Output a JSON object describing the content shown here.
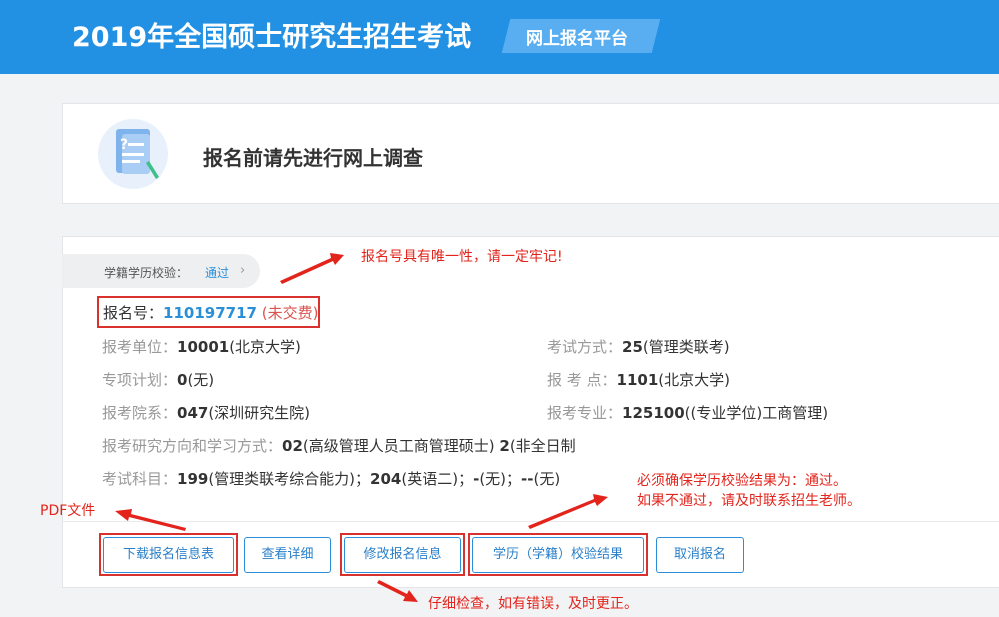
{
  "header": {
    "title": "2019年全国硕士研究生招生考试",
    "badge": "网上报名平台",
    "color": "#2291e4"
  },
  "survey": {
    "text": "报名前请先进行网上调查",
    "icon": "survey-document-icon"
  },
  "verify": {
    "label": "学籍学历校验：",
    "status": "通过",
    "chevron": "›"
  },
  "registration": {
    "label": "报名号：",
    "number": "110197717",
    "payment_status": "(未交费)"
  },
  "fields": {
    "unit": {
      "label": "报考单位：",
      "code": "10001",
      "name": "(北京大学)"
    },
    "exam_mode": {
      "label": "考试方式：",
      "code": "25",
      "name": "(管理类联考)"
    },
    "special_plan": {
      "label": "专项计划：",
      "code": "0",
      "name": "(无)"
    },
    "exam_site": {
      "label": "报 考 点：",
      "code": "1101",
      "name": "(北京大学)"
    },
    "department": {
      "label": "报考院系：",
      "code": "047",
      "name": "(深圳研究生院)"
    },
    "major": {
      "label": "报考专业：",
      "code": "125100",
      "name": "((专业学位)工商管理)"
    },
    "direction": {
      "label": "报考研究方向和学习方式：",
      "code1": "02",
      "name1": "(高级管理人员工商管理硕士) ",
      "code2": "2",
      "name2": "(非全日制"
    },
    "subjects": {
      "label": "考试科目：",
      "s1_code": "199",
      "s1_name": "(管理类联考综合能力)；",
      "s2_code": "204",
      "s2_name": "(英语二)；",
      "s3_code": "-",
      "s3_name": "(无)；",
      "s4_code": "--",
      "s4_name": "(无)"
    }
  },
  "buttons": {
    "download": "下载报名信息表",
    "details": "查看详细",
    "modify": "修改报名信息",
    "check_result": "学历（学籍）校验结果",
    "cancel": "取消报名"
  },
  "annotations": {
    "regno_note": "报名号具有唯一性，请一定牢记!",
    "verify_note_line1": "必须确保学历校验结果为：通过。",
    "verify_note_line2": "如果不通过，请及时联系招生老师。",
    "pdf_note": "PDF文件",
    "modify_note": "仔细检查，如有错误，及时更正。",
    "color": "#e3241c"
  }
}
